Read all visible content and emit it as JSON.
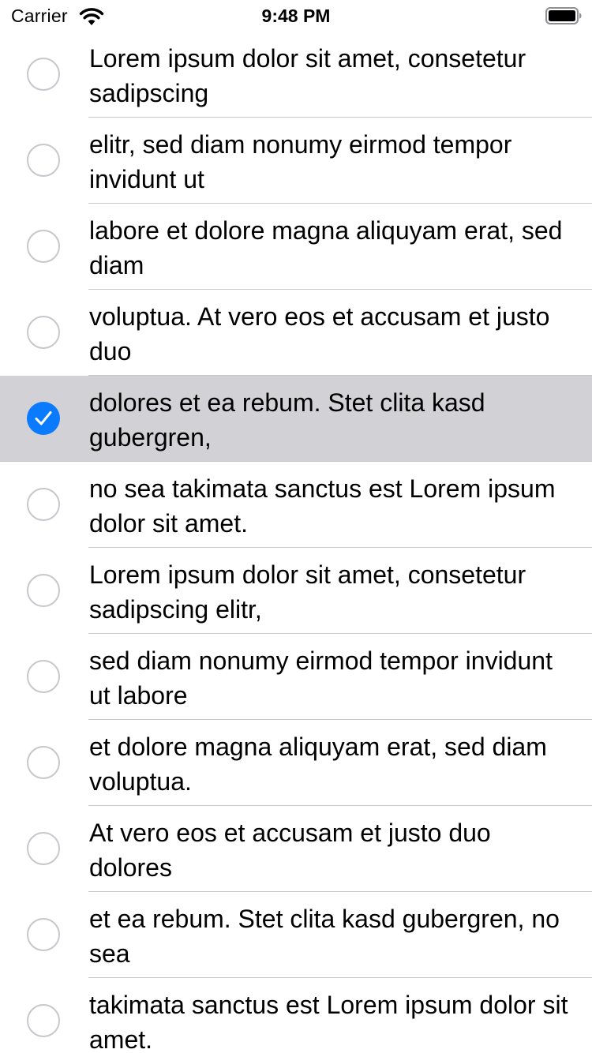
{
  "status_bar": {
    "carrier": "Carrier",
    "time": "9:48 PM",
    "wifi_icon": "wifi-icon",
    "battery_icon": "battery-icon"
  },
  "colors": {
    "accent": "#0a7aff",
    "selected_row": "#d1d1d6",
    "separator": "#c8c7cc",
    "unchecked_ring": "#c7c7cc"
  },
  "items": [
    {
      "label": "Lorem ipsum dolor sit amet, consetetur sadipscing",
      "selected": false
    },
    {
      "label": "elitr, sed diam nonumy eirmod tempor invidunt ut",
      "selected": false
    },
    {
      "label": "labore et dolore magna aliquyam erat, sed diam",
      "selected": false
    },
    {
      "label": "voluptua. At vero eos et accusam et justo duo",
      "selected": false
    },
    {
      "label": "dolores et ea rebum. Stet clita kasd gubergren,",
      "selected": true
    },
    {
      "label": "no sea takimata sanctus est Lorem ipsum dolor sit amet.",
      "selected": false
    },
    {
      "label": "Lorem ipsum dolor sit amet, consetetur sadipscing elitr,",
      "selected": false
    },
    {
      "label": "sed diam nonumy eirmod tempor invidunt ut labore",
      "selected": false
    },
    {
      "label": "et dolore magna aliquyam erat, sed diam voluptua.",
      "selected": false
    },
    {
      "label": "At vero eos et accusam et justo duo dolores",
      "selected": false
    },
    {
      "label": "et ea rebum. Stet clita kasd gubergren, no sea",
      "selected": false
    },
    {
      "label": "takimata sanctus est Lorem ipsum dolor sit amet.",
      "selected": false
    }
  ]
}
